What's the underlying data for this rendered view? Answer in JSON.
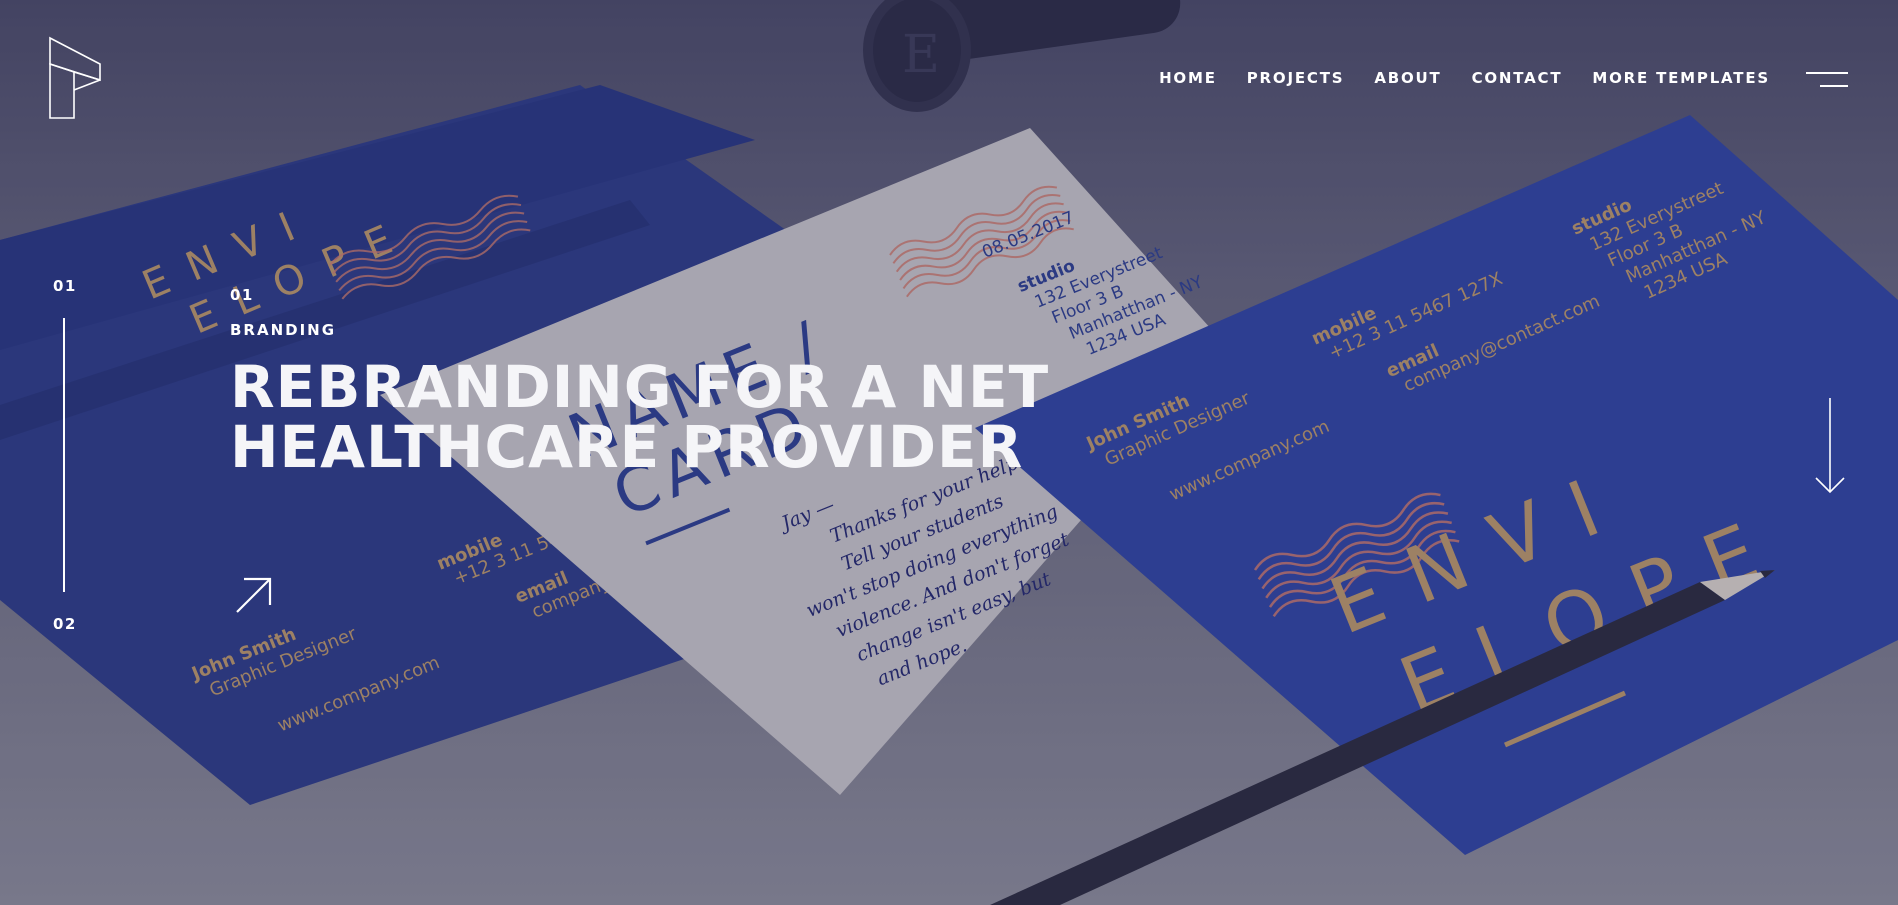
{
  "logo": {
    "icon": "logo-mark-icon"
  },
  "nav": {
    "items": [
      {
        "label": "HOME"
      },
      {
        "label": "PROJECTS"
      },
      {
        "label": "ABOUT"
      },
      {
        "label": "CONTACT"
      },
      {
        "label": "MORE TEMPLATES"
      }
    ],
    "menu_icon": "hamburger-menu-icon"
  },
  "slider": {
    "current": "01",
    "next": "02"
  },
  "hero": {
    "index": "01",
    "category": "BRANDING",
    "title": "REBRANDING FOR A NET HEALTHCARE PROVIDER",
    "link_icon": "arrow-up-right-icon",
    "scroll_icon": "arrow-down-icon"
  },
  "background": {
    "card_left": {
      "brand_line1": "ENVI",
      "brand_line2": "ELOPE",
      "name": "John Smith",
      "role": "Graphic Designer",
      "website": "www.company.com",
      "mobile_label": "mobile",
      "mobile": "+12 3 11 5467 127X",
      "email_label": "email",
      "email": "company@contact.com"
    },
    "card_center": {
      "date": "08.05.2017",
      "studio_label": "studio",
      "address1": "132 Everystreet",
      "address2": "Floor 3 B",
      "address3": "Manhatthan - NY",
      "address4": "1234 USA",
      "heading1": "NAME /",
      "heading2": "CARD",
      "note1": "Jay —",
      "note2": "Thanks for your help",
      "note3": "Tell your students",
      "note4": "won't stop doing everything",
      "note5": "violence. And don't forget",
      "note6": "change isn't easy, but",
      "note7": "and hope."
    },
    "card_right": {
      "studio_label": "studio",
      "address1": "132 Everystreet",
      "address2": "Floor 3 B",
      "address3": "Manhatthan - NY",
      "address4": "1234 USA",
      "mobile_label": "mobile",
      "mobile": "+12 3 11 5467 127X",
      "email_label": "email",
      "email": "company@contact.com",
      "name": "John Smith",
      "role": "Graphic Designer",
      "website": "www.company.com",
      "brand_line1": "ENVI",
      "brand_line2": "ELOPE"
    },
    "stamp_letter": "E",
    "colors": {
      "card_blue": "#2d3f8f",
      "paper": "#c9c6c9",
      "gold": "#b8956a",
      "salmon": "#c97a6e",
      "ink": "#23286e"
    }
  }
}
